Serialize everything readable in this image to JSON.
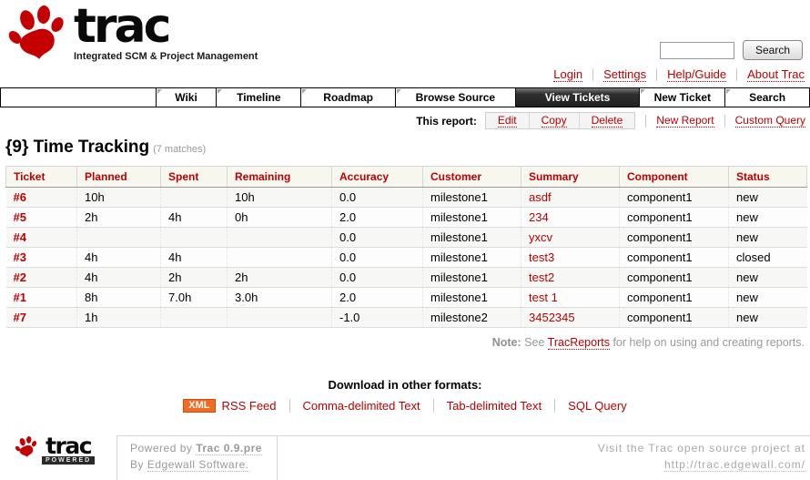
{
  "header": {
    "logo": {
      "title": "trac",
      "tagline": "Integrated SCM & Project Management"
    },
    "search": {
      "value": "",
      "button_label": "Search"
    },
    "metanav": [
      "Login",
      "Settings",
      "Help/Guide",
      "About Trac"
    ]
  },
  "mainnav": [
    {
      "label": "Wiki",
      "active": false
    },
    {
      "label": "Timeline",
      "active": false
    },
    {
      "label": "Roadmap",
      "active": false
    },
    {
      "label": "Browse Source",
      "active": false
    },
    {
      "label": "View Tickets",
      "active": true
    },
    {
      "label": "New Ticket",
      "active": false
    },
    {
      "label": "Search",
      "active": false
    }
  ],
  "report_toolbar": {
    "label": "This report:",
    "buttons": [
      "Edit",
      "Copy",
      "Delete"
    ],
    "links": [
      "New Report",
      "Custom Query"
    ]
  },
  "page": {
    "title": "{9} Time Tracking",
    "matches": "(7 matches)"
  },
  "table": {
    "columns": [
      "Ticket",
      "Planned",
      "Spent",
      "Remaining",
      "Accuracy",
      "Customer",
      "Summary",
      "Component",
      "Status"
    ],
    "rows": [
      {
        "ticket": "#6",
        "planned": "10h",
        "spent": "",
        "remaining": "10h",
        "accuracy": "0.0",
        "customer": "milestone1",
        "summary": "asdf",
        "component": "component1",
        "status": "new"
      },
      {
        "ticket": "#5",
        "planned": "2h",
        "spent": "4h",
        "remaining": "0h",
        "accuracy": "2.0",
        "customer": "milestone1",
        "summary": "234",
        "component": "component1",
        "status": "new"
      },
      {
        "ticket": "#4",
        "planned": "",
        "spent": "",
        "remaining": "",
        "accuracy": "0.0",
        "customer": "milestone1",
        "summary": "yxcv",
        "component": "component1",
        "status": "new"
      },
      {
        "ticket": "#3",
        "planned": "4h",
        "spent": "4h",
        "remaining": "",
        "accuracy": "0.0",
        "customer": "milestone1",
        "summary": "test3",
        "component": "component1",
        "status": "closed"
      },
      {
        "ticket": "#2",
        "planned": "4h",
        "spent": "2h",
        "remaining": "2h",
        "accuracy": "0.0",
        "customer": "milestone1",
        "summary": "test2",
        "component": "component1",
        "status": "new"
      },
      {
        "ticket": "#1",
        "planned": "8h",
        "spent": "7.0h",
        "remaining": "3.0h",
        "accuracy": "2.0",
        "customer": "milestone1",
        "summary": "test 1",
        "component": "component1",
        "status": "new"
      },
      {
        "ticket": "#7",
        "planned": "1h",
        "spent": "",
        "remaining": "",
        "accuracy": "-1.0",
        "customer": "milestone2",
        "summary": "3452345",
        "component": "component1",
        "status": "new"
      }
    ]
  },
  "note": {
    "label": "Note:",
    "before_link": "See",
    "link": "TracReports",
    "after_link": "for help on using and creating reports."
  },
  "downloads": {
    "heading": "Download in other formats:",
    "badge": "XML",
    "links": [
      "RSS Feed",
      "Comma-delimited Text",
      "Tab-delimited Text",
      "SQL Query"
    ]
  },
  "footer": {
    "logo_title": "trac",
    "logo_badge": "POWERED",
    "powered_prefix": "Powered by",
    "version_link": "Trac 0.9.pre",
    "by_prefix": "By",
    "company_link": "Edgewall Software.",
    "visit_text": "Visit the Trac open source project at",
    "visit_url": "http://trac.edgewall.com/"
  },
  "colors": {
    "accent": "#bb0000",
    "active_tab_bg": "#333333",
    "table_header_bg": "#f7f7f0",
    "xml_badge_bg": "#f36b21",
    "row_odd": "#f7f7f6",
    "row_even": "#fdfdfd"
  }
}
